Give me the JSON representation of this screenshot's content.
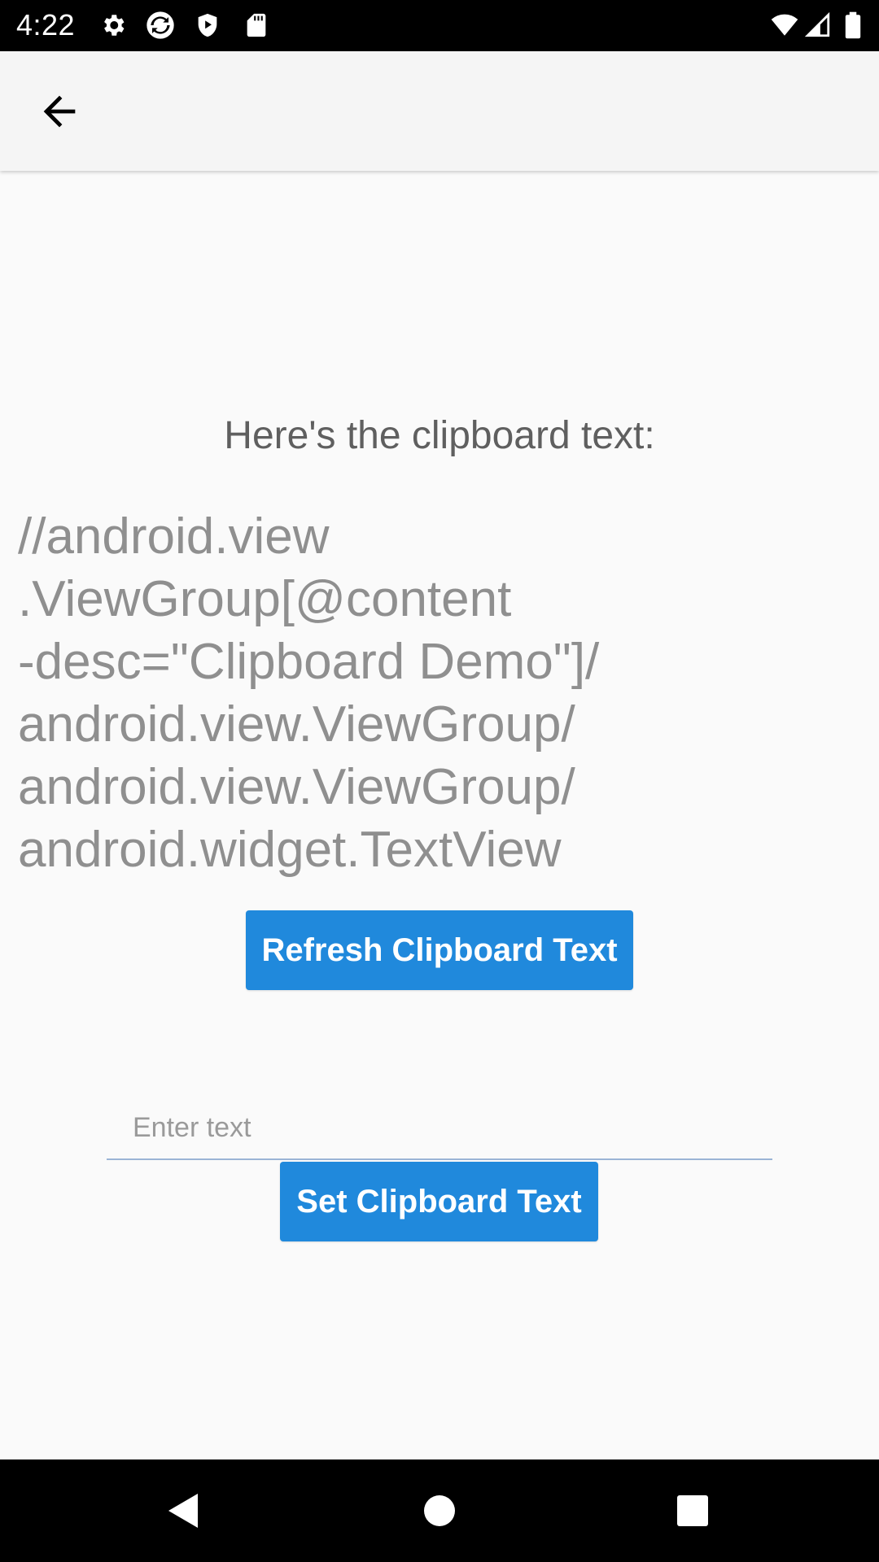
{
  "status_bar": {
    "time": "4:22",
    "left_icons": [
      "settings-icon",
      "sync-icon",
      "shield-play-icon",
      "sd-card-icon"
    ],
    "right_icons": [
      "wifi-icon",
      "signal-icon",
      "battery-icon"
    ]
  },
  "app_bar": {
    "back_icon": "arrow-back-icon"
  },
  "content": {
    "heading": "Here's the clipboard text:",
    "clipboard_text": "//android.view\n.ViewGroup[@content\n-desc=\"Clipboard Demo\"]/\nandroid.view.ViewGroup/\nandroid.view.ViewGroup/\nandroid.widget.TextView",
    "refresh_button_label": "Refresh Clipboard Text",
    "input": {
      "placeholder": "Enter text",
      "value": ""
    },
    "set_button_label": "Set Clipboard Text"
  },
  "nav_bar": {
    "icons": [
      "back-triangle-icon",
      "home-circle-icon",
      "recents-square-icon"
    ]
  },
  "colors": {
    "accent": "#2089dc",
    "background": "#fafafa",
    "app_bar": "#f5f5f5"
  }
}
